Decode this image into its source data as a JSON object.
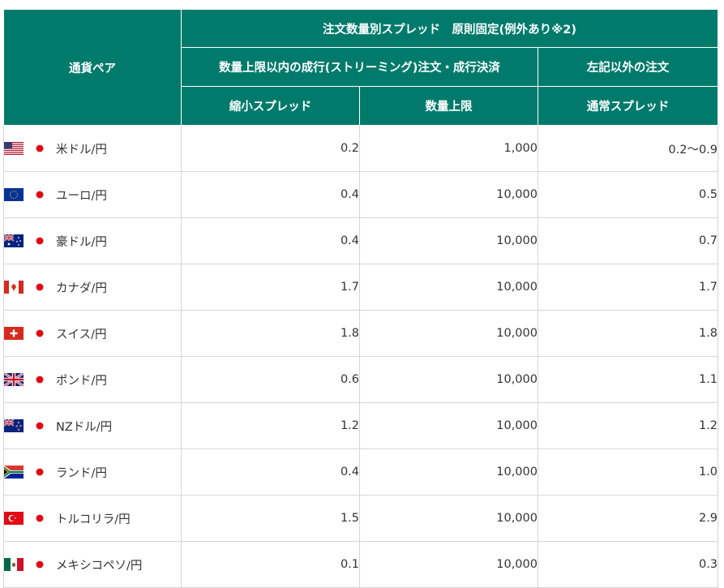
{
  "header": {
    "currency_pair": "通貨ペア",
    "top_group": "注文数量別スプレッド　原則固定(例外あり※2)",
    "streaming_group": "数量上限以内の成行(ストリーミング)注文・成行決済",
    "other_orders": "左記以外の注文",
    "reduced_spread": "縮小スプレッド",
    "quantity_limit": "数量上限",
    "normal_spread": "通常スプレッド"
  },
  "rows": [
    {
      "flag": "us-flag-icon",
      "pair": "米ドル/円",
      "reduced": "0.2",
      "limit": "1,000",
      "normal": "0.2〜0.9"
    },
    {
      "flag": "eu-flag-icon",
      "pair": "ユーロ/円",
      "reduced": "0.4",
      "limit": "10,000",
      "normal": "0.5"
    },
    {
      "flag": "au-flag-icon",
      "pair": "豪ドル/円",
      "reduced": "0.4",
      "limit": "10,000",
      "normal": "0.7"
    },
    {
      "flag": "ca-flag-icon",
      "pair": "カナダ/円",
      "reduced": "1.7",
      "limit": "10,000",
      "normal": "1.7"
    },
    {
      "flag": "ch-flag-icon",
      "pair": "スイス/円",
      "reduced": "1.8",
      "limit": "10,000",
      "normal": "1.8"
    },
    {
      "flag": "gb-flag-icon",
      "pair": "ポンド/円",
      "reduced": "0.6",
      "limit": "10,000",
      "normal": "1.1"
    },
    {
      "flag": "nz-flag-icon",
      "pair": "NZドル/円",
      "reduced": "1.2",
      "limit": "10,000",
      "normal": "1.2"
    },
    {
      "flag": "za-flag-icon",
      "pair": "ランド/円",
      "reduced": "0.4",
      "limit": "10,000",
      "normal": "1.0"
    },
    {
      "flag": "tr-flag-icon",
      "pair": "トルコリラ/円",
      "reduced": "1.5",
      "limit": "10,000",
      "normal": "2.9"
    },
    {
      "flag": "mx-flag-icon",
      "pair": "メキシコペソ/円",
      "reduced": "0.1",
      "limit": "10,000",
      "normal": "0.3"
    }
  ],
  "colors": {
    "header_bg": "#007b6b",
    "header_text": "#ffffff",
    "border": "#d6d6d6",
    "text": "#333333"
  }
}
